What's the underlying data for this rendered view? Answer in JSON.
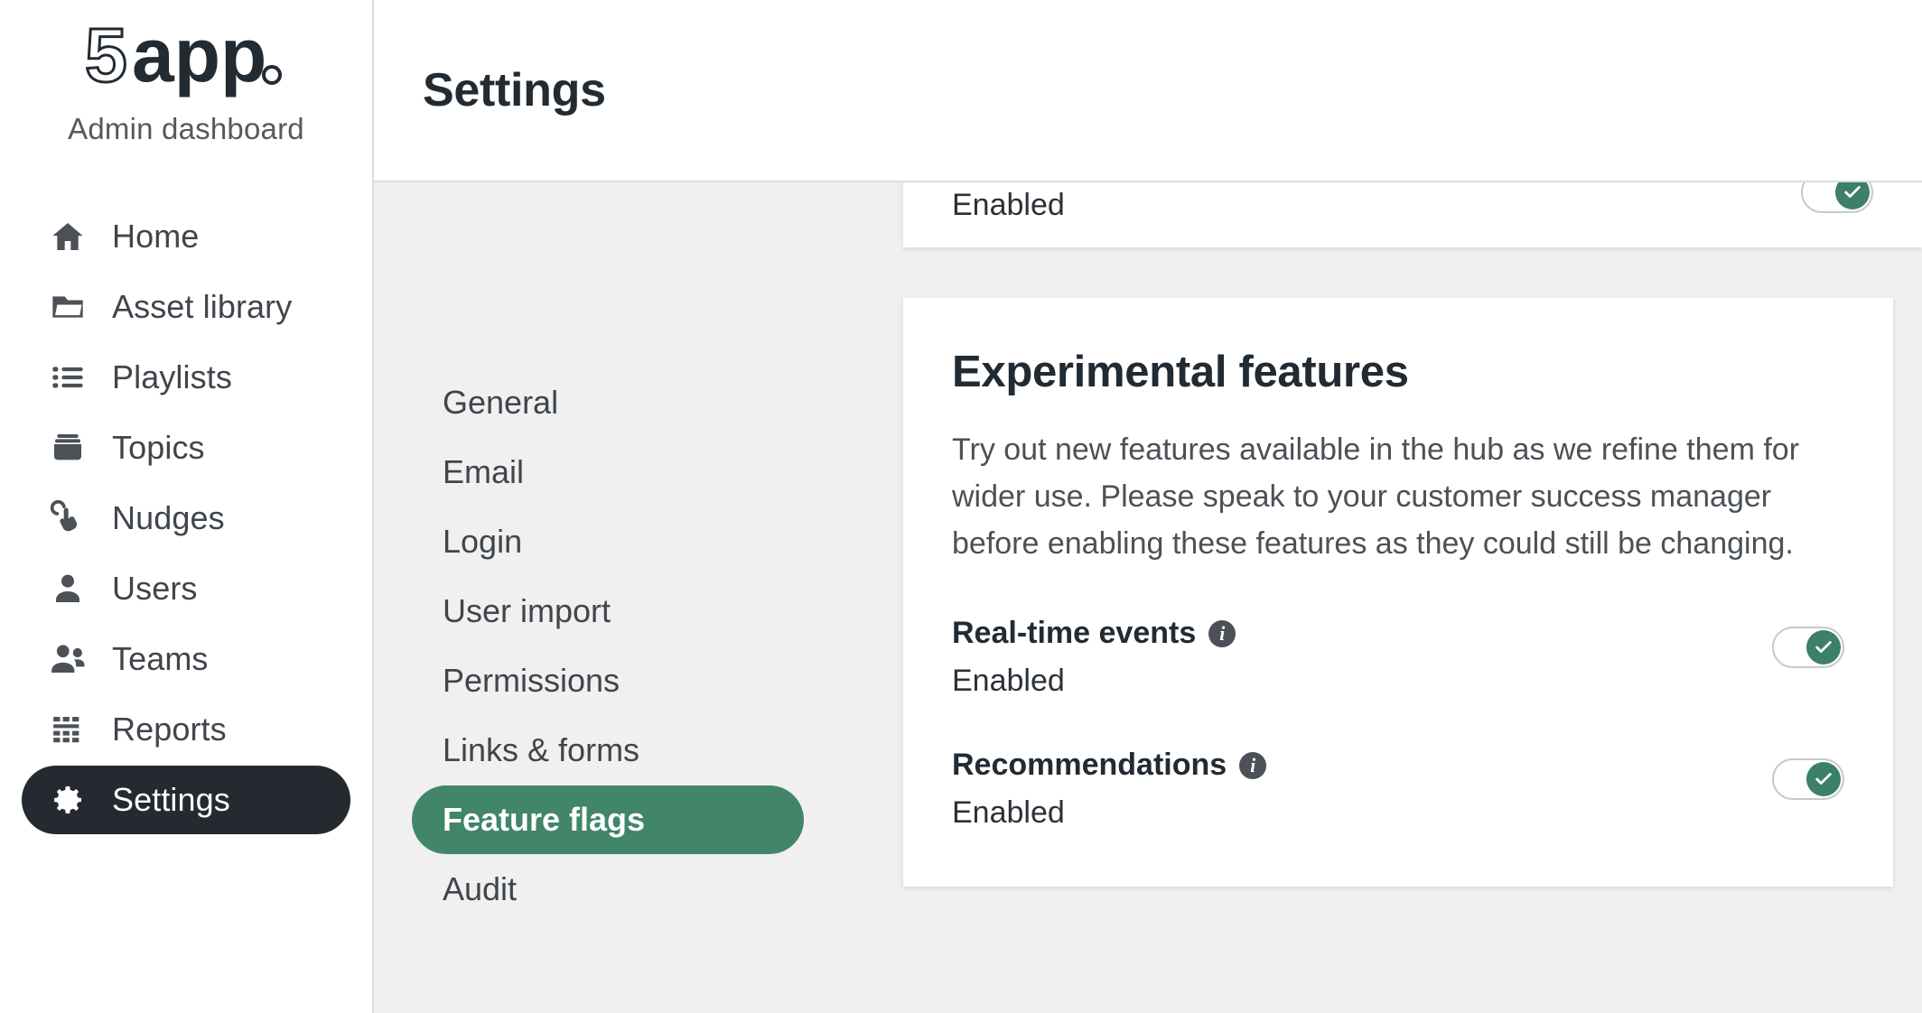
{
  "brand": {
    "logo_text": "5app.",
    "subtitle": "Admin dashboard"
  },
  "sidebar": {
    "items": [
      {
        "label": "Home",
        "icon": "home-icon",
        "active": false
      },
      {
        "label": "Asset library",
        "icon": "folder-icon",
        "active": false
      },
      {
        "label": "Playlists",
        "icon": "list-icon",
        "active": false
      },
      {
        "label": "Topics",
        "icon": "archive-box-icon",
        "active": false
      },
      {
        "label": "Nudges",
        "icon": "hand-tap-icon",
        "active": false
      },
      {
        "label": "Users",
        "icon": "user-icon",
        "active": false
      },
      {
        "label": "Teams",
        "icon": "users-group-icon",
        "active": false
      },
      {
        "label": "Reports",
        "icon": "table-grid-icon",
        "active": false
      },
      {
        "label": "Settings",
        "icon": "gear-icon",
        "active": true
      }
    ]
  },
  "header": {
    "title": "Settings"
  },
  "submenu": {
    "items": [
      {
        "label": "General",
        "active": false
      },
      {
        "label": "Email",
        "active": false
      },
      {
        "label": "Login",
        "active": false
      },
      {
        "label": "User import",
        "active": false
      },
      {
        "label": "Permissions",
        "active": false
      },
      {
        "label": "Links & forms",
        "active": false
      },
      {
        "label": "Feature flags",
        "active": true
      },
      {
        "label": "Audit",
        "active": false
      }
    ]
  },
  "cards": {
    "partial_top": {
      "state_label": "Enabled",
      "toggle_on": true
    },
    "experimental": {
      "heading": "Experimental features",
      "description": "Try out new features available in the hub as we refine them for wider use. Please speak to your customer success manager before enabling these features as they could still be changing.",
      "flags": [
        {
          "name": "Real-time events",
          "state_label": "Enabled",
          "toggle_on": true,
          "info_glyph": "i"
        },
        {
          "name": "Recommendations",
          "state_label": "Enabled",
          "toggle_on": true,
          "info_glyph": "i"
        }
      ]
    }
  },
  "colors": {
    "accent_green": "#41856a",
    "toggle_green": "#3d8068",
    "active_dark": "#242a30",
    "page_bg": "#f0f0f0"
  }
}
